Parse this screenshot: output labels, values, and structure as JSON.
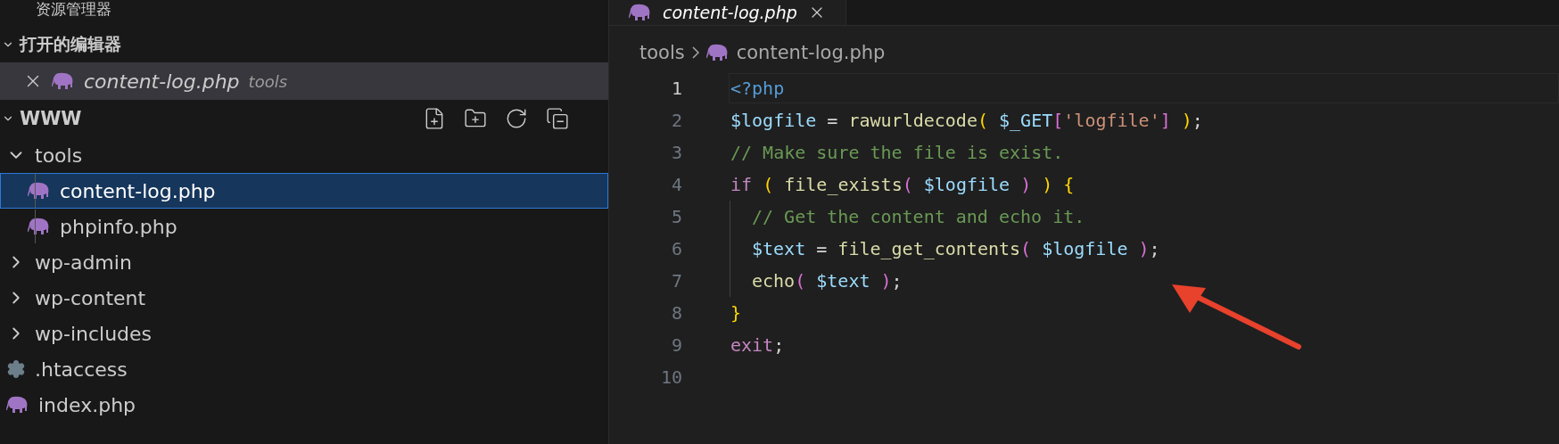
{
  "explorer": {
    "title": "资源管理器",
    "open_editors": {
      "title": "打开的编辑器",
      "expanded": true,
      "items": [
        {
          "name": "content-log.php",
          "folder": "tools",
          "kind": "php",
          "selected": true
        }
      ]
    },
    "folder": {
      "title": "WWW",
      "expanded": true,
      "items": [
        {
          "name": "tools",
          "kind": "folder",
          "expanded": true,
          "children": [
            {
              "name": "content-log.php",
              "kind": "php",
              "selected": true
            },
            {
              "name": "phpinfo.php",
              "kind": "php",
              "selected": false
            }
          ]
        },
        {
          "name": "wp-admin",
          "kind": "folder",
          "expanded": false
        },
        {
          "name": "wp-content",
          "kind": "folder",
          "expanded": false
        },
        {
          "name": "wp-includes",
          "kind": "folder",
          "expanded": false
        },
        {
          "name": ".htaccess",
          "kind": "config",
          "selected": false
        },
        {
          "name": "index.php",
          "kind": "php",
          "selected": false
        }
      ]
    }
  },
  "tabs": [
    {
      "label": "content-log.php",
      "kind": "php",
      "selected": true
    }
  ],
  "breadcrumb": [
    {
      "label": "tools",
      "kind": "folder"
    },
    {
      "label": "content-log.php",
      "kind": "php"
    }
  ],
  "code": [
    {
      "number": "1",
      "current": true,
      "indented": false,
      "tokens": [
        {
          "text": "<?php",
          "kind": "tag"
        }
      ]
    },
    {
      "number": "2",
      "current": false,
      "indented": false,
      "tokens": [
        {
          "text": "$logfile",
          "kind": "variable"
        },
        {
          "text": " = ",
          "kind": "plain"
        },
        {
          "text": "rawurldecode",
          "kind": "function"
        },
        {
          "text": "(",
          "kind": "bracket1"
        },
        {
          "text": " $_GET",
          "kind": "variable"
        },
        {
          "text": "[",
          "kind": "bracket2"
        },
        {
          "text": "'logfile'",
          "kind": "string"
        },
        {
          "text": "]",
          "kind": "bracket2"
        },
        {
          "text": " )",
          "kind": "bracket1"
        },
        {
          "text": ";",
          "kind": "plain"
        }
      ]
    },
    {
      "number": "3",
      "current": false,
      "indented": false,
      "tokens": [
        {
          "text": "// Make sure the file is exist.",
          "kind": "comment"
        }
      ]
    },
    {
      "number": "4",
      "current": false,
      "indented": false,
      "tokens": [
        {
          "text": "if",
          "kind": "keyword"
        },
        {
          "text": " (",
          "kind": "bracket1"
        },
        {
          "text": " file_exists",
          "kind": "function"
        },
        {
          "text": "(",
          "kind": "bracket2"
        },
        {
          "text": " $logfile",
          "kind": "variable"
        },
        {
          "text": " )",
          "kind": "bracket2"
        },
        {
          "text": " )",
          "kind": "bracket1"
        },
        {
          "text": " {",
          "kind": "bracket1"
        }
      ]
    },
    {
      "number": "5",
      "current": false,
      "indented": true,
      "tokens": [
        {
          "text": "// Get the content and echo it.",
          "kind": "comment"
        }
      ]
    },
    {
      "number": "6",
      "current": false,
      "indented": true,
      "tokens": [
        {
          "text": "$text",
          "kind": "variable"
        },
        {
          "text": " = ",
          "kind": "plain"
        },
        {
          "text": "file_get_contents",
          "kind": "function"
        },
        {
          "text": "(",
          "kind": "bracket2"
        },
        {
          "text": " $logfile",
          "kind": "variable"
        },
        {
          "text": " )",
          "kind": "bracket2"
        },
        {
          "text": ";",
          "kind": "plain"
        }
      ]
    },
    {
      "number": "7",
      "current": false,
      "indented": true,
      "tokens": [
        {
          "text": "echo",
          "kind": "function"
        },
        {
          "text": "(",
          "kind": "bracket2"
        },
        {
          "text": " $text",
          "kind": "variable"
        },
        {
          "text": " )",
          "kind": "bracket2"
        },
        {
          "text": ";",
          "kind": "plain"
        }
      ]
    },
    {
      "number": "8",
      "current": false,
      "indented": false,
      "tokens": [
        {
          "text": "}",
          "kind": "bracket1"
        }
      ]
    },
    {
      "number": "9",
      "current": false,
      "indented": false,
      "tokens": [
        {
          "text": "exit",
          "kind": "keyword"
        },
        {
          "text": ";",
          "kind": "plain"
        }
      ]
    },
    {
      "number": "10",
      "current": false,
      "indented": false
    }
  ]
}
